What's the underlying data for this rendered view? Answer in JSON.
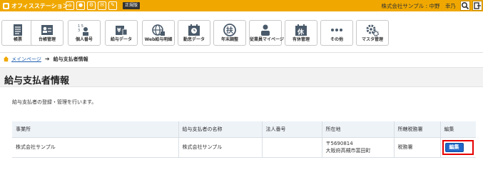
{
  "header": {
    "brand": "オフィスステーション",
    "edition": "正規版",
    "company": "株式会社サンプル",
    "user_name": "中野　幸乃",
    "mini_icons": [
      "home-icon",
      "user-icon",
      "settings-icon",
      "mail-icon",
      "edit-icon"
    ]
  },
  "toolbar": {
    "items": [
      {
        "label": "帳票",
        "icon": "ledger-icon"
      },
      {
        "label": "台帳管理",
        "icon": "register-icon"
      },
      {
        "label": "個人番号",
        "icon": "my-number-icon"
      },
      {
        "label": "給与データ",
        "icon": "payroll-data-icon"
      },
      {
        "label": "Web給与明細",
        "icon": "web-payslip-icon"
      },
      {
        "label": "勤怠データ",
        "icon": "attendance-icon"
      },
      {
        "label": "年末調整",
        "icon": "year-end-icon"
      },
      {
        "label": "従業員マイページ",
        "icon": "employee-page-icon"
      },
      {
        "label": "有休管理",
        "icon": "paid-leave-icon"
      },
      {
        "label": "その他",
        "icon": "more-icon"
      },
      {
        "label": "マスタ管理",
        "icon": "master-settings-icon"
      }
    ]
  },
  "breadcrumb": {
    "home": "メインページ",
    "current": "給与支払者情報"
  },
  "page": {
    "title": "給与支払者情報",
    "description": "給与支払者の登録・管理を行います。"
  },
  "table": {
    "headers": [
      "事業所",
      "給与支払者の名称",
      "法人番号",
      "所在地",
      "所轄税務署",
      "編集"
    ],
    "row": {
      "office": "株式会社サンプル",
      "payer_name": "株式会社サンプル",
      "corporate_number": "",
      "postal_code": "〒5690814",
      "address": "大阪府高槻市富田町",
      "tax_office": "税務署",
      "edit_label": "編集"
    }
  },
  "colors": {
    "topbar": "#f0a800",
    "link": "#1f5fb0",
    "edit_button": "#1f67c9",
    "highlight": "#e60000"
  }
}
